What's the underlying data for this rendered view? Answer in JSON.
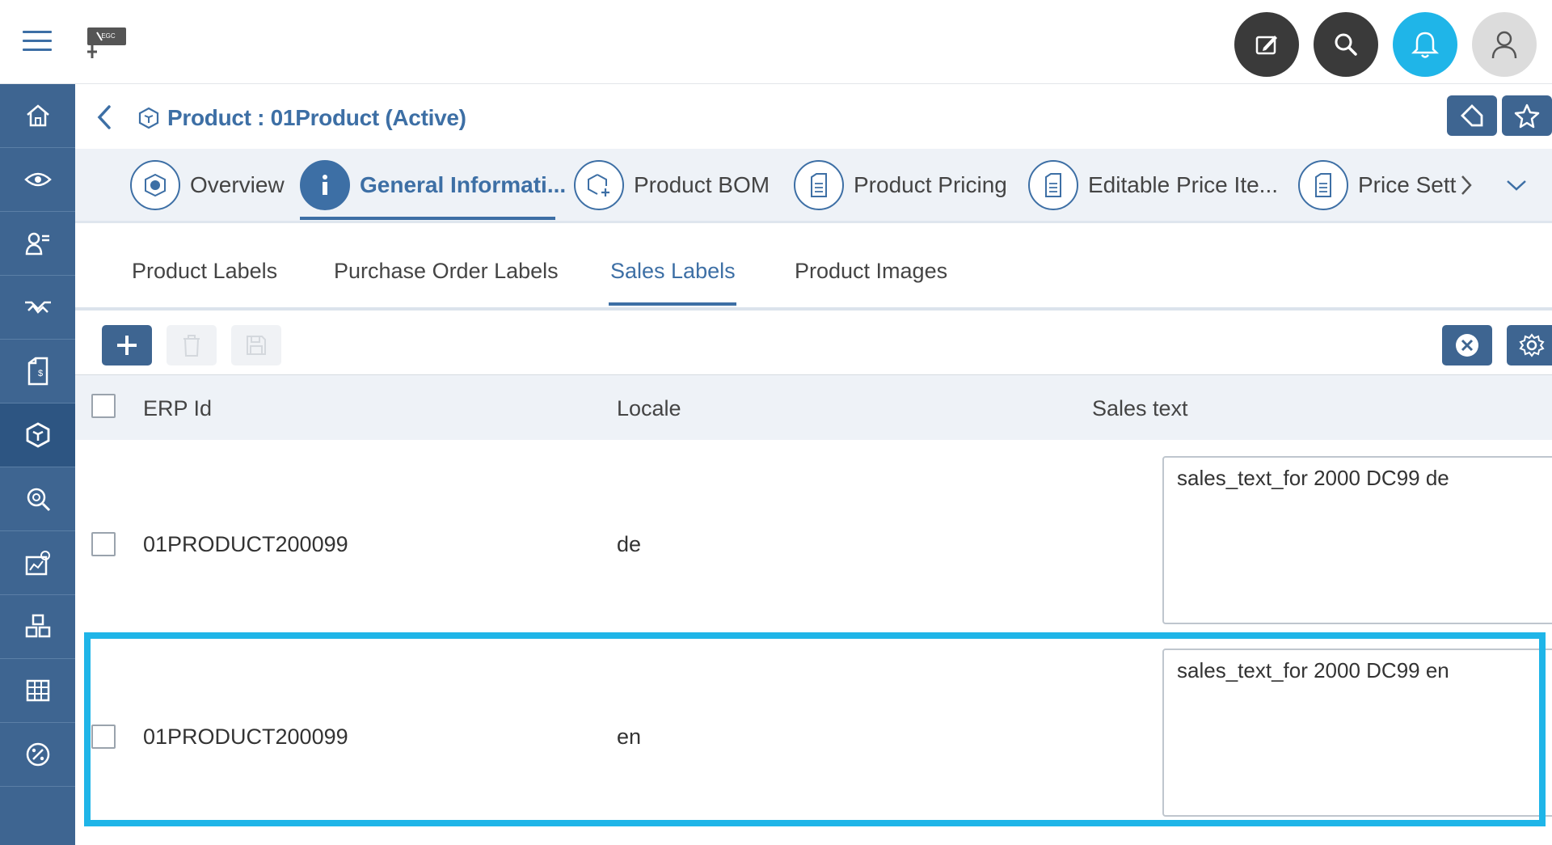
{
  "app": {
    "logo_text": "EGC"
  },
  "topbar": {
    "actions": [
      {
        "name": "edit-icon"
      },
      {
        "name": "search-icon"
      },
      {
        "name": "bell-icon"
      },
      {
        "name": "user-icon"
      }
    ]
  },
  "sidebar": {
    "items": [
      {
        "icon": "home-icon"
      },
      {
        "icon": "eye-icon"
      },
      {
        "icon": "user-list-icon"
      },
      {
        "icon": "handshake-icon"
      },
      {
        "icon": "document-price-icon"
      },
      {
        "icon": "product-box-icon",
        "active": true
      },
      {
        "icon": "search-gear-icon"
      },
      {
        "icon": "chart-settings-icon"
      },
      {
        "icon": "cubes-icon"
      },
      {
        "icon": "grid-icon"
      },
      {
        "icon": "percent-icon"
      }
    ]
  },
  "header": {
    "title": "Product : 01Product (Active)"
  },
  "main_tabs": [
    {
      "label": "Overview"
    },
    {
      "label": "General Informati..."
    },
    {
      "label": "Product BOM"
    },
    {
      "label": "Product Pricing"
    },
    {
      "label": "Editable Price Ite..."
    },
    {
      "label": "Price Sett"
    }
  ],
  "sub_tabs": [
    {
      "label": "Product Labels"
    },
    {
      "label": "Purchase Order Labels"
    },
    {
      "label": "Sales Labels"
    },
    {
      "label": "Product Images"
    }
  ],
  "table": {
    "columns": [
      "ERP Id",
      "Locale",
      "Sales text"
    ],
    "rows": [
      {
        "erp_id": "01PRODUCT200099",
        "locale": "de",
        "sales_text": "sales_text_for 2000 DC99 de"
      },
      {
        "erp_id": "01PRODUCT200099",
        "locale": "en",
        "sales_text": "sales_text_for 2000 DC99 en"
      }
    ]
  },
  "colors": {
    "accent": "#3d6fa5",
    "sidebar": "#3e6591",
    "highlight": "#1fb5e8"
  }
}
